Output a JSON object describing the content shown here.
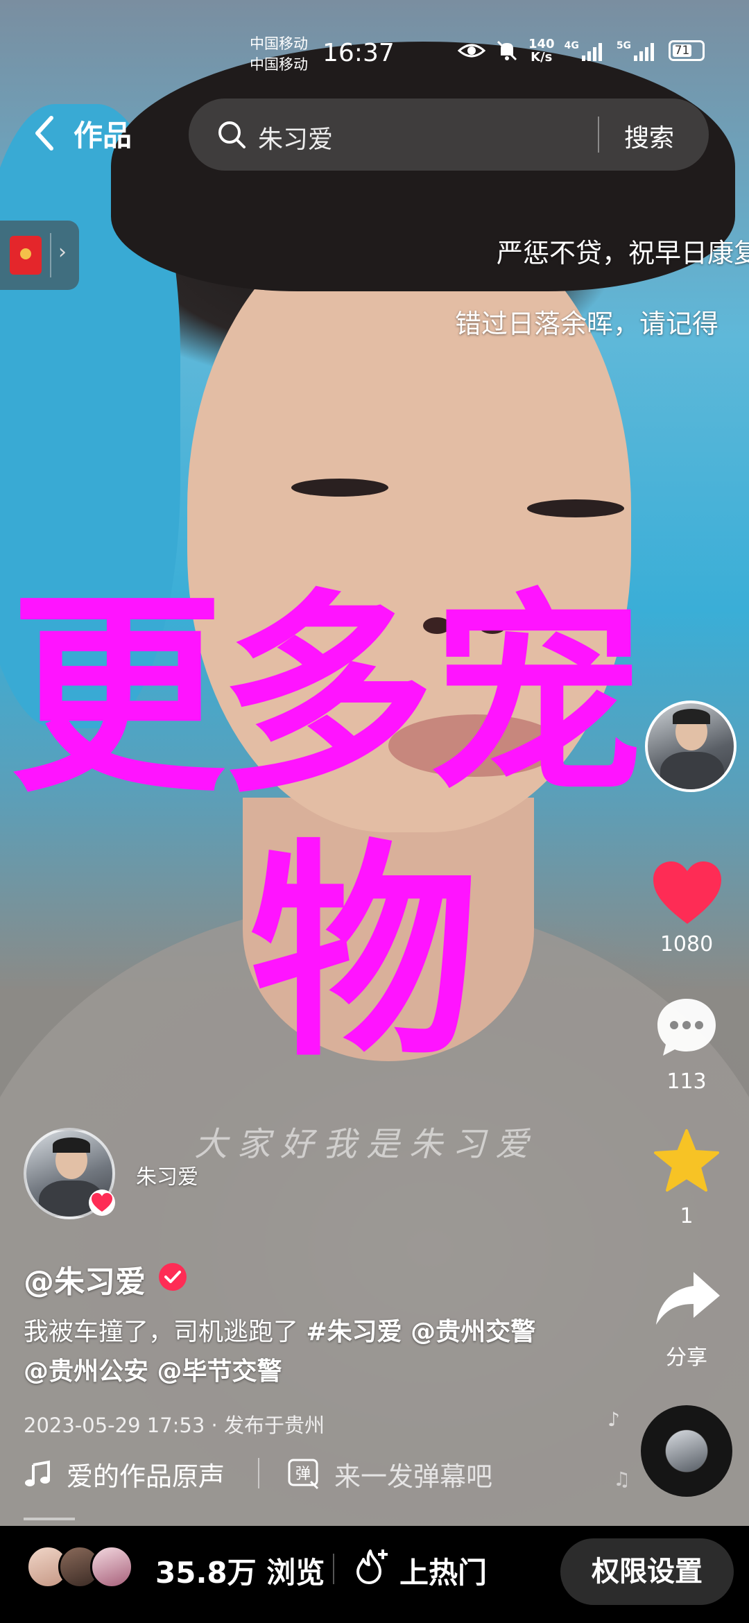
{
  "status_bar": {
    "carrier_1": "中国移动",
    "carrier_2": "中国移动",
    "time": "16:37",
    "net_speed_value": "140",
    "net_speed_unit": "K/s",
    "signal_1": "4G",
    "signal_2": "5G",
    "battery": "71"
  },
  "header": {
    "back_label": "作品",
    "search_query": "朱习爱",
    "search_button": "搜索"
  },
  "danmaku": [
    "严惩不贷，祝早日康复",
    "错过日落余晖，请记得"
  ],
  "overlay": {
    "line1": "更多宠",
    "line2": "物"
  },
  "video_watermark": "大家好我是朱习爱",
  "actions": {
    "likes": "1080",
    "comments": "113",
    "favorites": "1",
    "share_label": "分享"
  },
  "author": {
    "name_small": "朱习爱",
    "handle": "@朱习爱"
  },
  "caption": {
    "text": "我被车撞了，司机逃跑了 ",
    "hashtag": "#朱习爱",
    "mentions": " @贵州交警 @贵州公安 @毕节交警"
  },
  "meta": {
    "datetime": "2023-05-29 17:53",
    "location": "发布于贵州"
  },
  "music": {
    "title": "爱的作品原声"
  },
  "danmaku_input": {
    "placeholder": "来一发弹幕吧"
  },
  "bottom_bar": {
    "views": "35.8万 浏览",
    "hot_label": "上热门",
    "permission_button": "权限设置"
  },
  "colors": {
    "overlay_text": "#ff14ff",
    "like_red": "#fe2c55",
    "star_yellow": "#f7c325"
  }
}
